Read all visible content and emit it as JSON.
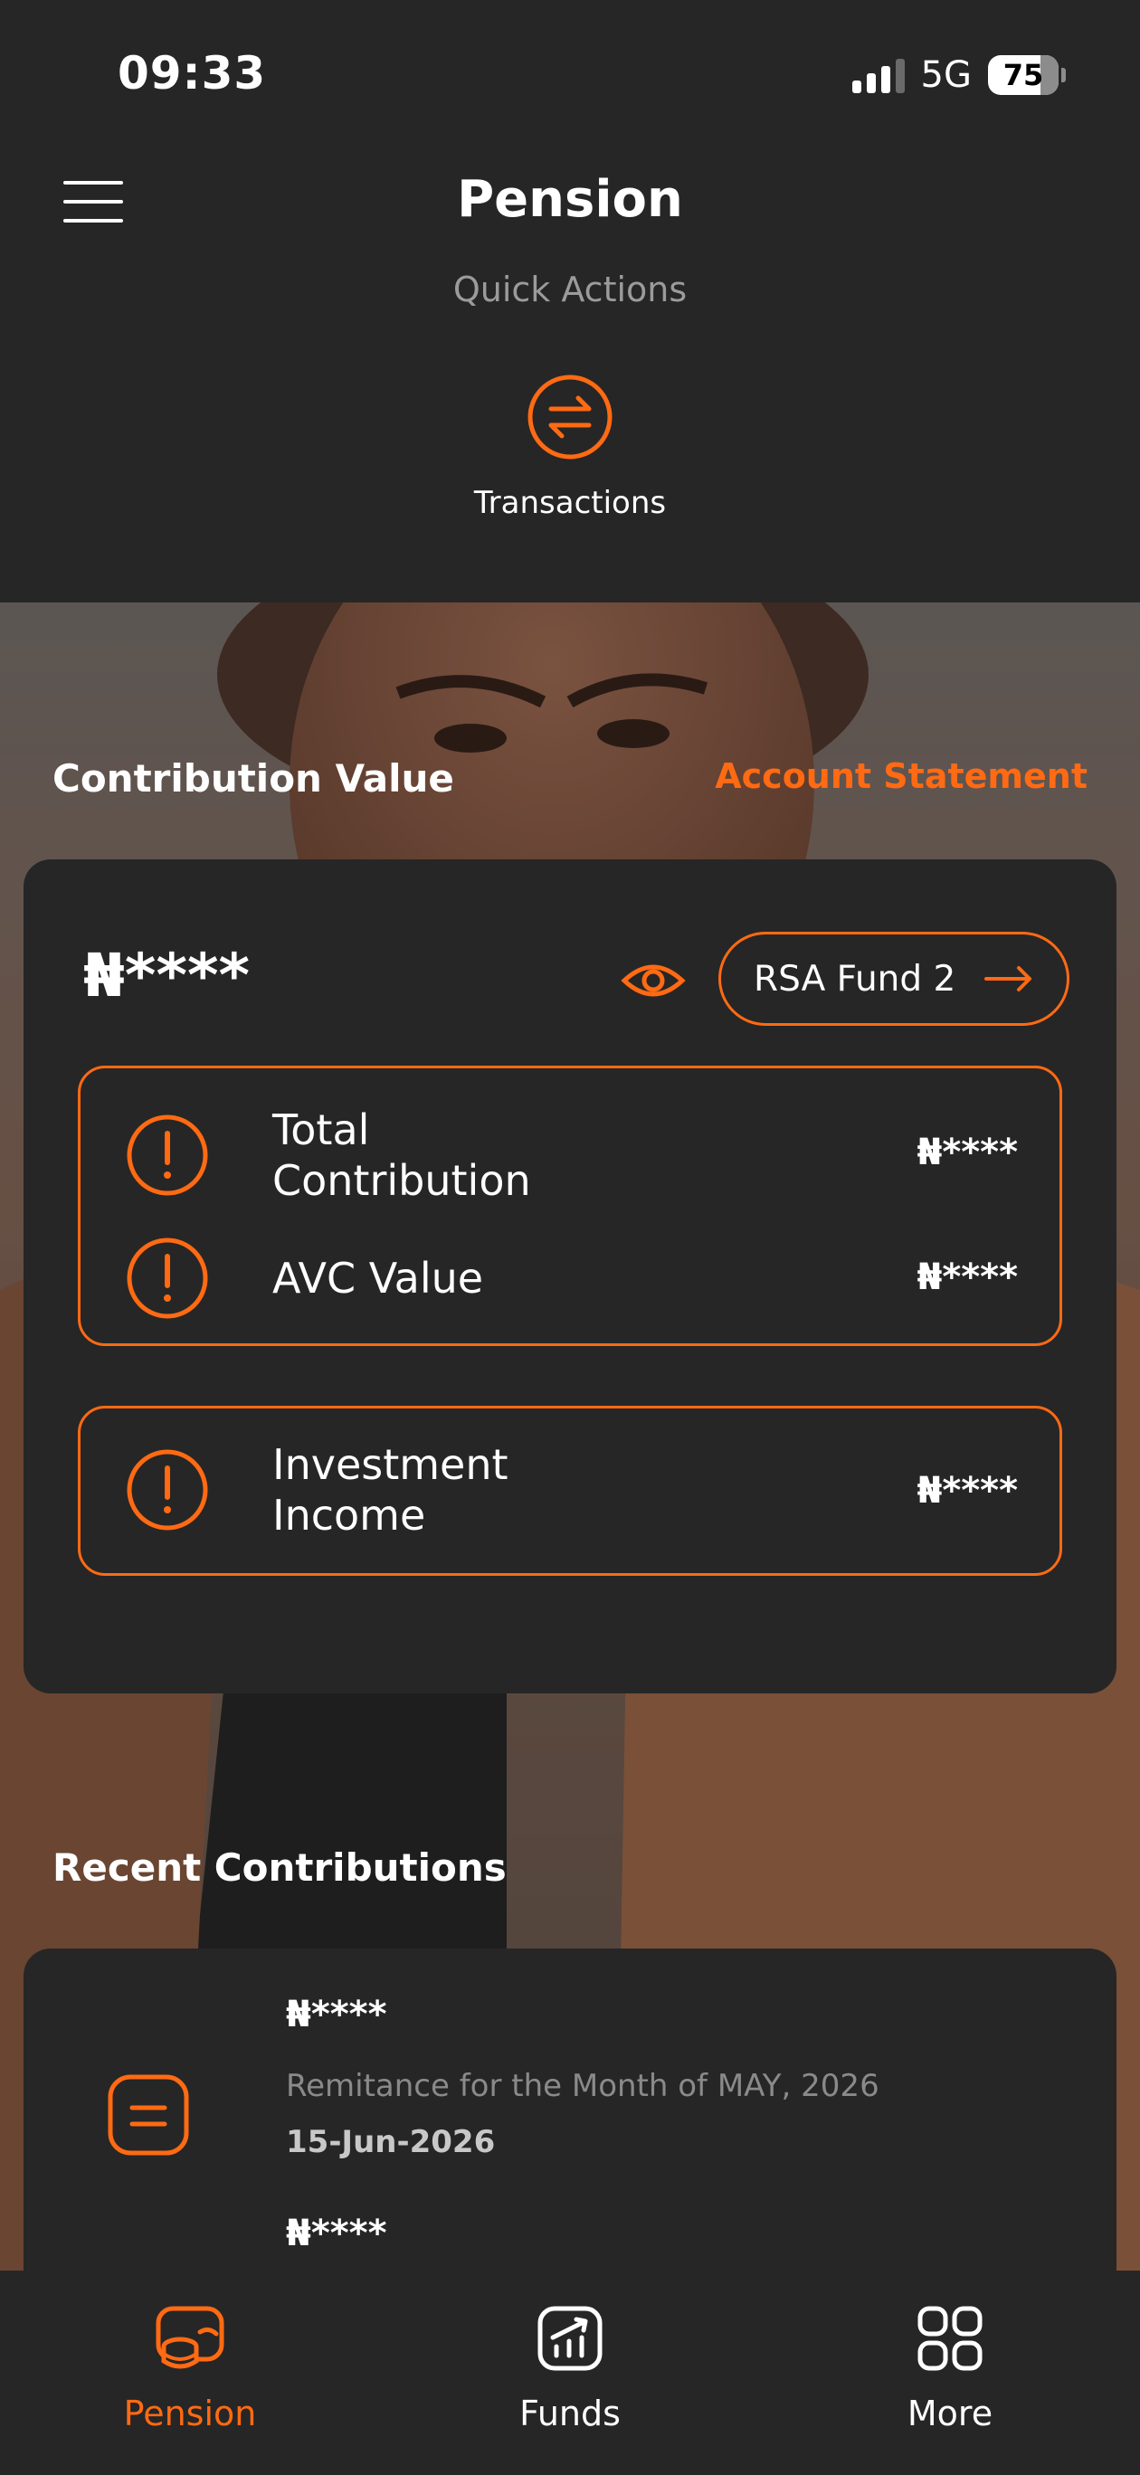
{
  "status_bar": {
    "time": "09:33",
    "network": "5G",
    "battery": "75"
  },
  "header": {
    "title": "Pension",
    "menu_icon": "hamburger-icon"
  },
  "quick_actions": {
    "label": "Quick Actions",
    "items": [
      {
        "label": "Transactions",
        "icon": "transfer-arrows-icon"
      }
    ]
  },
  "contribution": {
    "section_title": "Contribution Value",
    "statement_link": "Account Statement",
    "balance": "₦****",
    "fund_button": "RSA Fund 2",
    "rows": [
      {
        "label": "Total\nContribution",
        "value": "₦****"
      },
      {
        "label": "AVC Value",
        "value": "₦****"
      },
      {
        "label": "Investment\nIncome",
        "value": "₦****"
      }
    ]
  },
  "recent": {
    "section_title": "Recent Contributions",
    "items": [
      {
        "amount": "₦****",
        "description": "Remitance for the Month of MAY, 2026",
        "date": "15-Jun-2026"
      },
      {
        "amount": "₦****"
      }
    ]
  },
  "bottom_nav": {
    "items": [
      {
        "label": "Pension",
        "icon": "pension-coins-icon",
        "active": true
      },
      {
        "label": "Funds",
        "icon": "chart-growth-icon",
        "active": false
      },
      {
        "label": "More",
        "icon": "grid-icon",
        "active": false
      }
    ]
  },
  "colors": {
    "accent": "#ff6a13",
    "background": "#262626",
    "muted_text": "#8a8a8a"
  }
}
